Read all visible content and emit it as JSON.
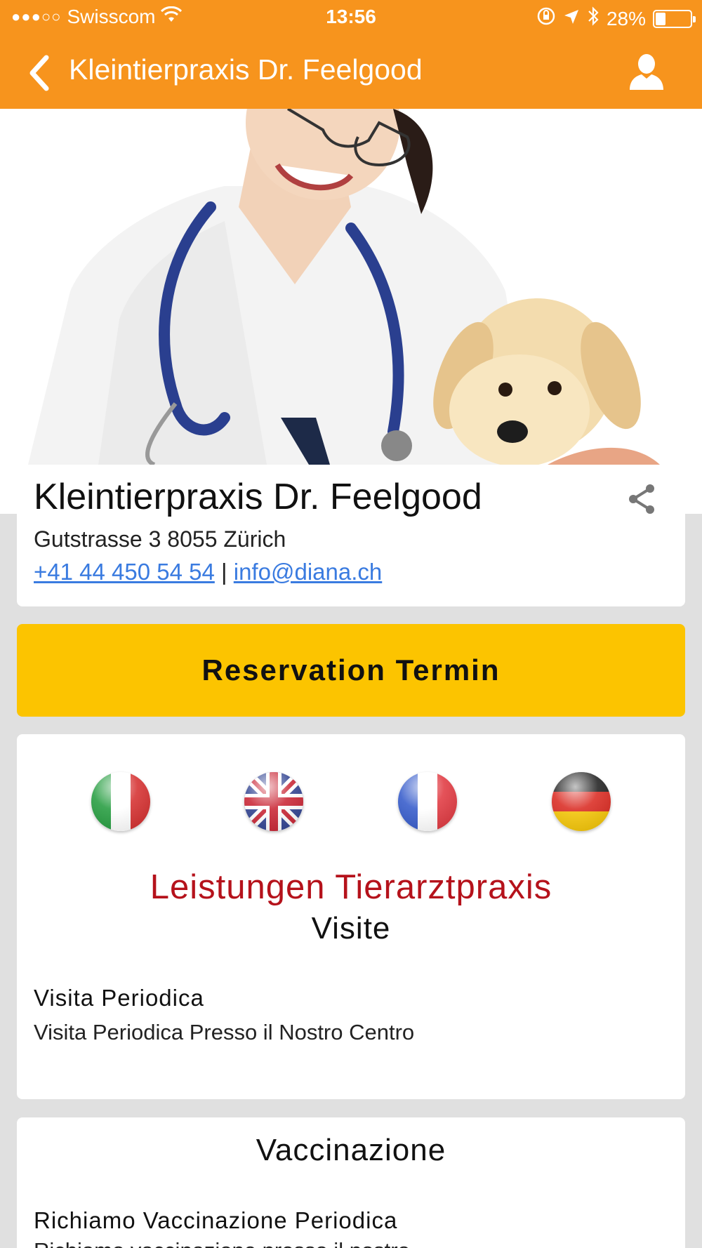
{
  "status_bar": {
    "carrier": "Swisscom",
    "signal": "●●●○○",
    "time": "13:56",
    "battery_percent": "28%",
    "battery_level": 0.28
  },
  "header": {
    "title": "Kleintierpraxis Dr. Feelgood",
    "back_icon": "chevron-left-icon",
    "user_icon": "user-icon",
    "background_color": "#f7941d"
  },
  "clinic": {
    "name": "Kleintierpraxis Dr. Feelgood",
    "address": "Gutstrasse 3 8055 Zürich",
    "phone": "+41 44 450 54 54",
    "separator": "|",
    "email": "info@diana.ch"
  },
  "reserve_button": {
    "label": "Reservation Termin",
    "color": "#fcc400"
  },
  "languages": [
    "it",
    "en",
    "fr",
    "de"
  ],
  "services": {
    "title": "Leistungen Tierarztpraxis",
    "title_color": "#b5121b",
    "category": "Visite",
    "items": [
      {
        "title": "Visita Periodica",
        "description": "Visita Periodica Presso il Nostro Centro"
      }
    ]
  },
  "vaccination": {
    "title": "Vaccinazione",
    "items": [
      {
        "title": "Richiamo Vaccinazione Periodica",
        "description": "Richiamo vaccinazione presso il nostro"
      }
    ]
  }
}
